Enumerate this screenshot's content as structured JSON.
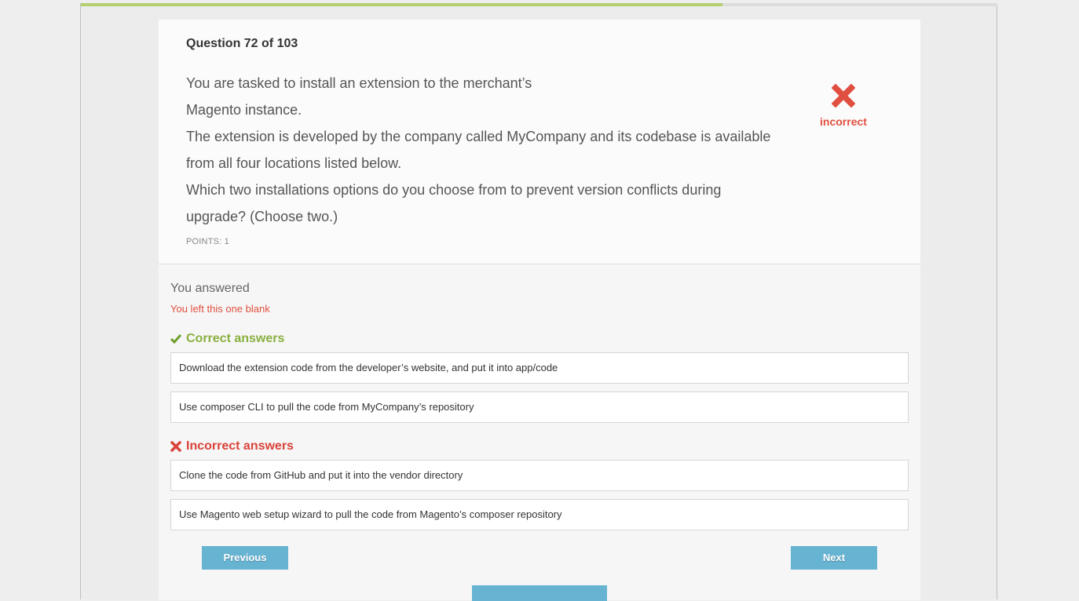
{
  "progress": {
    "fraction": 0.7
  },
  "question": {
    "number_label": "Question 72 of 103",
    "lines": [
      "You are tasked to install an extension to the merchant’s",
      "Magento instance.",
      "The extension is developed by the company called MyCompany and its codebase is available from all four locations listed below.",
      "Which two installations options do you choose from to prevent version conflicts during upgrade? (Choose two.)"
    ],
    "points": "POINTS: 1"
  },
  "result": {
    "label": "incorrect",
    "icon": "x-icon",
    "color": "#e04f3f"
  },
  "response": {
    "heading": "You answered",
    "note": "You left this one blank"
  },
  "correct": {
    "heading": "Correct answers",
    "icon": "checkmark-icon",
    "items": [
      "Download the extension code from the developer’s website, and put it into app/code",
      "Use composer CLI to pull the code from MyCompany’s repository"
    ]
  },
  "incorrect": {
    "heading": "Incorrect answers",
    "icon": "x-icon",
    "items": [
      "Clone the code from GitHub and put it into the vendor directory",
      "Use Magento web setup wizard to pull the code from Magento’s composer repository"
    ]
  },
  "nav": {
    "previous": "Previous",
    "next": "Next"
  },
  "colors": {
    "accent": "#67b3d2",
    "correct": "#8ab040",
    "incorrect": "#d9433a",
    "progress": "#b3cf72"
  }
}
